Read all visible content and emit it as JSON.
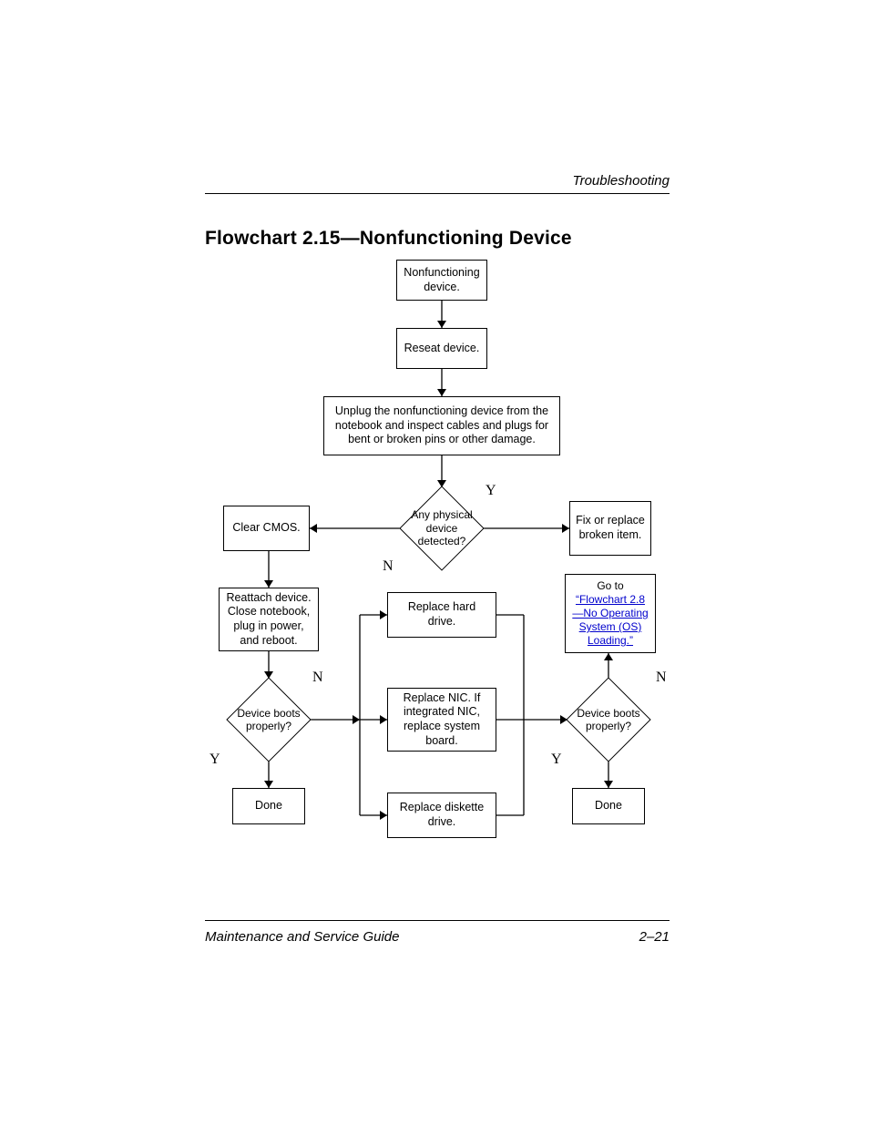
{
  "header": {
    "section": "Troubleshooting"
  },
  "title": "Flowchart 2.15—Nonfunctioning Device",
  "footer": {
    "left": "Maintenance and Service Guide",
    "right": "2–21"
  },
  "nodes": {
    "start": "Nonfunctioning device.",
    "reseat": "Reseat device.",
    "unplug": "Unplug the nonfunctioning device from the notebook and inspect cables and plugs for bent or broken pins or other damage.",
    "physical": "Any physical device detected?",
    "clearcmos": "Clear CMOS.",
    "fix": "Fix or replace broken item.",
    "reattach": "Reattach device. Close notebook, plug in power, and reboot.",
    "goto_prefix": "Go to ",
    "goto_link": "“Flowchart 2.8—No Operating System (OS) Loading.”",
    "hdd": "Replace hard drive.",
    "nic": "Replace NIC. If integrated NIC, replace system board.",
    "diskette": "Replace diskette drive.",
    "boots_left": "Device boots properly?",
    "boots_right": "Device boots properly?",
    "done_left": "Done",
    "done_right": "Done"
  },
  "labels": {
    "Y": "Y",
    "N": "N"
  }
}
